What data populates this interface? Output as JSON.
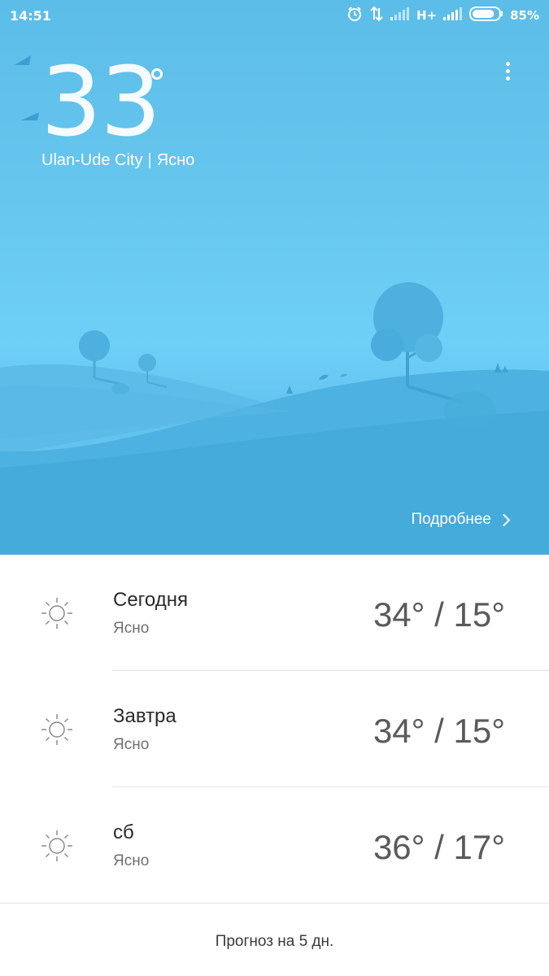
{
  "status_bar": {
    "time": "14:51",
    "network": "H+",
    "battery_percent": "85%",
    "battery_level": 0.85,
    "icons": [
      "alarm-icon",
      "data-transfer-icon",
      "signal-weak-icon",
      "signal-icon",
      "battery-icon"
    ]
  },
  "current": {
    "temperature": "33",
    "city": "Ulan-Ude City",
    "separator": "|",
    "condition": "Ясно"
  },
  "details_link": "Подробнее",
  "forecast": [
    {
      "day": "Сегодня",
      "condition": "Ясно",
      "range": "34° / 15°",
      "icon": "sun-icon"
    },
    {
      "day": "Завтра",
      "condition": "Ясно",
      "range": "34° / 15°",
      "icon": "sun-icon"
    },
    {
      "day": "сб",
      "condition": "Ясно",
      "range": "36° / 17°",
      "icon": "sun-icon"
    }
  ],
  "five_day_link": "Прогноз на 5 дн.",
  "colors": {
    "sky_top": "#5cbde8",
    "hill_back": "#5ab9e6",
    "hill_front": "#46aedd",
    "tree": "#4fb2e0"
  }
}
